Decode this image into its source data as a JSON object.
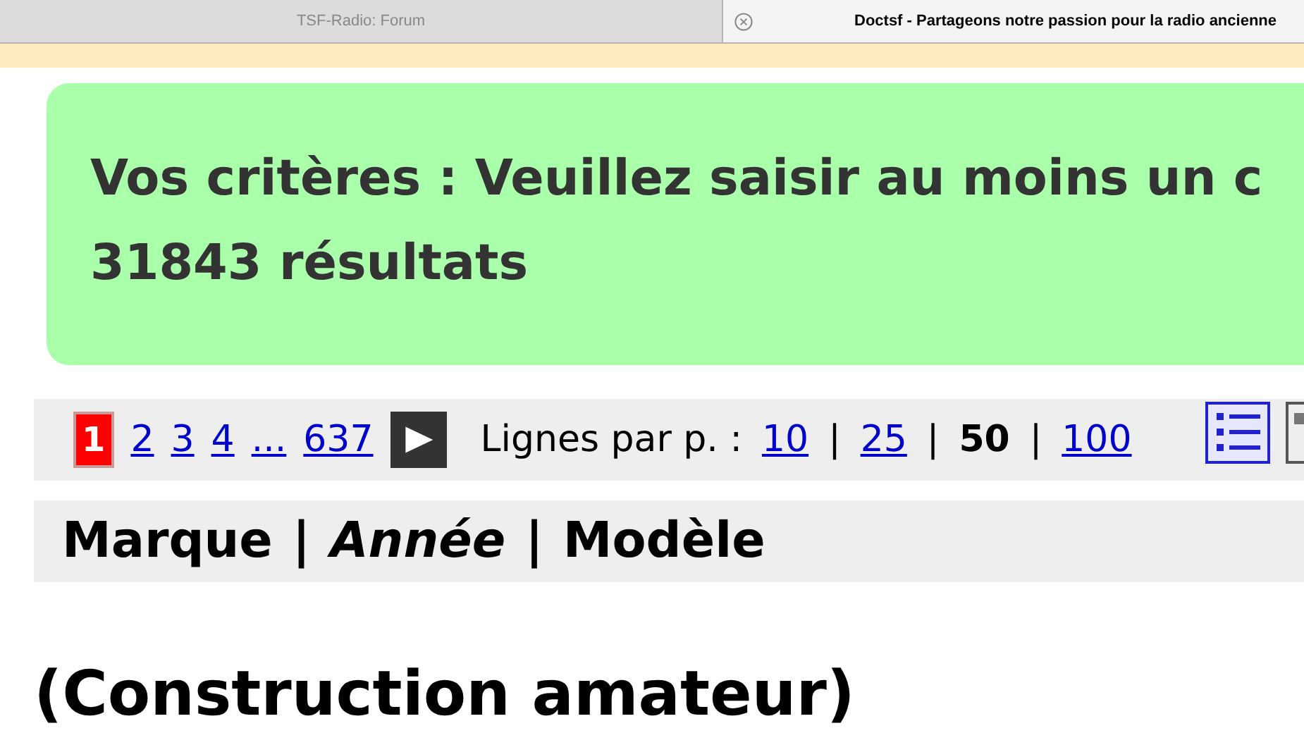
{
  "tabs": [
    {
      "label": "TSF-Radio: Forum",
      "selected": false
    },
    {
      "label": "Doctsf - Partageons notre passion pour la radio ancienne",
      "selected": true
    }
  ],
  "criteria": {
    "line": "Vos critères : Veuillez saisir au moins un c",
    "count": "31843 résultats"
  },
  "pager": {
    "pages": [
      {
        "label": "1",
        "selected": true
      },
      {
        "label": "2",
        "selected": false
      },
      {
        "label": "3",
        "selected": false
      },
      {
        "label": "4",
        "selected": false
      },
      {
        "label": "...",
        "selected": false
      },
      {
        "label": "637",
        "selected": false
      }
    ],
    "per_page_label": "Lignes par p. :",
    "per_page": [
      {
        "label": "10",
        "selected": false
      },
      {
        "label": "25",
        "selected": false
      },
      {
        "label": "50",
        "selected": true
      },
      {
        "label": "100",
        "selected": false
      }
    ],
    "separator": "|"
  },
  "sort": {
    "items": [
      {
        "label": "Marque",
        "selected": false
      },
      {
        "label": "Année",
        "selected": true
      },
      {
        "label": "Modèle",
        "selected": false
      }
    ],
    "separator": "|"
  },
  "heading": "(Construction amateur)"
}
